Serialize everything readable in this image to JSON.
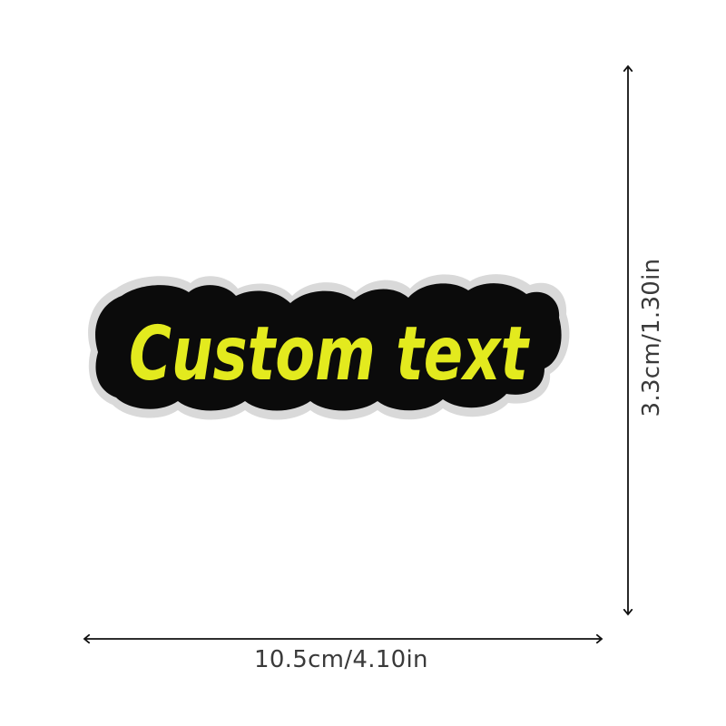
{
  "patch": {
    "text": "Custom text",
    "text_color": "#e3ea1e",
    "fill_color": "#0b0b0b",
    "border_color": "#d9d9d9"
  },
  "dimensions": {
    "width_label": "10.5cm/4.10in",
    "height_label": "3.3cm/1.30in",
    "arrow_color": "#111111"
  }
}
